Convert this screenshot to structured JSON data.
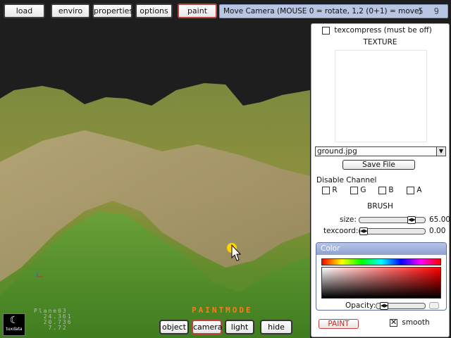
{
  "toolbar": {
    "buttons": [
      "load",
      "enviro",
      "properties",
      "options",
      "paint"
    ],
    "status": "Move Camera (MOUSE 0 = rotate, 1,2 (0+1) = move)",
    "fps": "5 9"
  },
  "panel": {
    "texcompress_label": "texcompress (must be off)",
    "texcompress_checked": false,
    "texture_title": "TEXTURE",
    "texture_file": "ground.jpg",
    "save_file": "Save File",
    "disable_channel_label": "Disable Channel",
    "channels": [
      "R",
      "G",
      "B",
      "A"
    ],
    "brush_title": "BRUSH",
    "size_label": "size:",
    "size_value": "65.00",
    "texcoord_label": "texcoord:",
    "texcoord_value": "0.00",
    "color_title": "Color",
    "opacity_label": "Opacity:",
    "paint_button": "PAINT",
    "smooth_label": "smooth",
    "smooth_checked": true
  },
  "bottom": {
    "buttons": [
      "object",
      "camera",
      "light",
      "hide"
    ],
    "mode": "PAINTMODE"
  },
  "overlay": {
    "coords": "Plane03\n  24.361\n  20.736\n   7.72",
    "logo_text": "tuxdata"
  },
  "colors": {
    "status_bg": "#b8c6e4",
    "active_border": "#c04040",
    "mode_text": "#ff7a1a",
    "cursor": "#ffd400"
  }
}
